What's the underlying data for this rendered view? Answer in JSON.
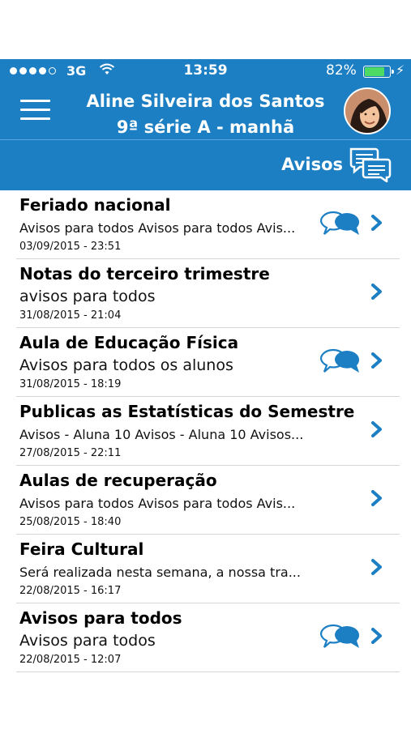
{
  "status_bar": {
    "carrier": "3G",
    "time": "13:59",
    "battery": "82%",
    "battery_level": 0.82,
    "icons": [
      "signal-dots-icon",
      "wifi-icon",
      "battery-icon",
      "charging-bolt-icon"
    ]
  },
  "header": {
    "menu_icon": "hamburger-menu-icon",
    "student_name": "Aline Silveira dos Santos",
    "class_name": "9ª série A - manhã",
    "avatar": "student-avatar"
  },
  "section": {
    "title": "Avisos",
    "icon": "chat-bubbles-icon"
  },
  "colors": {
    "header_blue": "#1d7fc3",
    "icon_blue": "#1d7fc3",
    "divider": "#d6d6d6"
  },
  "notices": [
    {
      "title": "Feriado nacional",
      "description": "Avisos para todos Avisos para todos Avis...",
      "date": "03/09/2015 - 23:51",
      "has_comments": true
    },
    {
      "title": "Notas do terceiro trimestre",
      "description": "avisos para todos",
      "date": "31/08/2015 - 21:04",
      "has_comments": false
    },
    {
      "title": "Aula de Educação Física",
      "description": "Avisos para todos os alunos",
      "date": "31/08/2015 - 18:19",
      "has_comments": true
    },
    {
      "title": "Publicas as Estatísticas do Semestre",
      "description": "Avisos - Aluna 10 Avisos - Aluna 10 Avisos...",
      "date": "27/08/2015 - 22:11",
      "has_comments": false
    },
    {
      "title": "Aulas de recuperação",
      "description": "Avisos para todos Avisos para todos Avis...",
      "date": "25/08/2015 - 18:40",
      "has_comments": false
    },
    {
      "title": "Feira Cultural",
      "description": "Será realizada nesta semana, a nossa tra...",
      "date": "22/08/2015 - 16:17",
      "has_comments": false
    },
    {
      "title": "Avisos para todos",
      "description": "Avisos para todos",
      "date": "22/08/2015 - 12:07",
      "has_comments": true
    }
  ]
}
